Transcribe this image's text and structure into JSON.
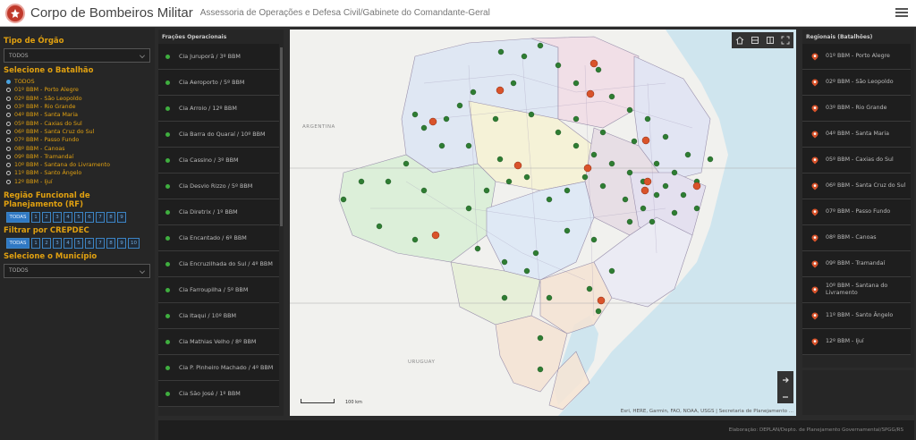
{
  "header": {
    "title": "Corpo de Bombeiros Militar",
    "subtitle": "Assessoria de Operações e Defesa Civil/Gabinete do Comandante-Geral"
  },
  "left_panel": {
    "tipo_orgao_title": "Tipo de Órgão",
    "tipo_orgao_value": "TODOS",
    "batalhao_title": "Selecione o Batalhão",
    "batalhoes": [
      {
        "label": "TODOS",
        "selected": true
      },
      {
        "label": "01º BBM - Porto Alegre",
        "selected": false
      },
      {
        "label": "02º BBM - São Leopoldo",
        "selected": false
      },
      {
        "label": "03º BBM - Rio Grande",
        "selected": false
      },
      {
        "label": "04º BBM - Santa Maria",
        "selected": false
      },
      {
        "label": "05º BBM - Caxias do Sul",
        "selected": false
      },
      {
        "label": "06º BBM - Santa Cruz do Sul",
        "selected": false
      },
      {
        "label": "07º BBM - Passo Fundo",
        "selected": false
      },
      {
        "label": "08º BBM - Canoas",
        "selected": false
      },
      {
        "label": "09º BBM - Tramandaí",
        "selected": false
      },
      {
        "label": "10º BBM - Santana do Livramento",
        "selected": false
      },
      {
        "label": "11º BBM - Santo Ângelo",
        "selected": false
      },
      {
        "label": "12º BBM - Ijuí",
        "selected": false
      }
    ],
    "rf_title": "Região Funcional de Planejamento (RF)",
    "rf_options": [
      "TODAS",
      "1",
      "2",
      "3",
      "4",
      "5",
      "6",
      "7",
      "8",
      "9"
    ],
    "crepdec_title": "Filtrar por CREPDEC",
    "crepdec_options": [
      "TODAS",
      "1",
      "2",
      "3",
      "4",
      "5",
      "6",
      "7",
      "8",
      "9",
      "10"
    ],
    "municipio_title": "Selecione o Município",
    "municipio_value": "TODOS"
  },
  "mid_panel": {
    "title": "Frações Operacionais",
    "items": [
      "Cia Juruporã / 3º BBM",
      "Cia Aeroporto / 5º BBM",
      "Cia Arroio / 12º BBM",
      "Cia Barra do Quaraí / 10º BBM",
      "Cia Cassino / 3º BBM",
      "Cia Desvio Rizzo / 5º BBM",
      "Cia Diretrix / 1º BBM",
      "Cia Encantado / 6º BBM",
      "Cia Encruzilhada do Sul / 4º BBM",
      "Cia Farroupilha / 5º BBM",
      "Cia Itaqui / 10º BBM",
      "Cia Mathias Velho / 8º BBM",
      "Cia P. Pinheiro Machado / 4º BBM",
      "Cia São José / 1º BBM"
    ]
  },
  "right_panel": {
    "title": "Regionais (Batalhões)",
    "items": [
      "01º BBM - Porto Alegre",
      "02º BBM - São Leopoldo",
      "03º BBM - Rio Grande",
      "04º BBM - Santa Maria",
      "05º BBM - Caxias do Sul",
      "06º BBM - Santa Cruz do Sul",
      "07º BBM - Passo Fundo",
      "08º BBM - Canoas",
      "09º BBM - Tramandaí",
      "10º BBM - Santana do Livramento",
      "11º BBM - Santo Ângelo",
      "12º BBM - Ijuí"
    ]
  },
  "map": {
    "labels": {
      "argentina": "ARGENTINA",
      "uruguay": "URUGUAY"
    },
    "scale_label": "100 km",
    "attribution": "Esri, HERE, Garmin, FAO, NOAA, USGS | Secretaria de Planejamento ...",
    "toolbar": [
      "home-icon",
      "layers-icon",
      "basemap-icon",
      "fullscreen-icon"
    ]
  },
  "footer": {
    "text": "Elaboração: DEPLAN/Depto. de Planejamento Governamental/SPGG/RS"
  },
  "colors": {
    "accent": "#e0a010",
    "selected_blue": "#2f78c4",
    "station_green": "#2e7d32",
    "battalion_red": "#d9532b"
  }
}
